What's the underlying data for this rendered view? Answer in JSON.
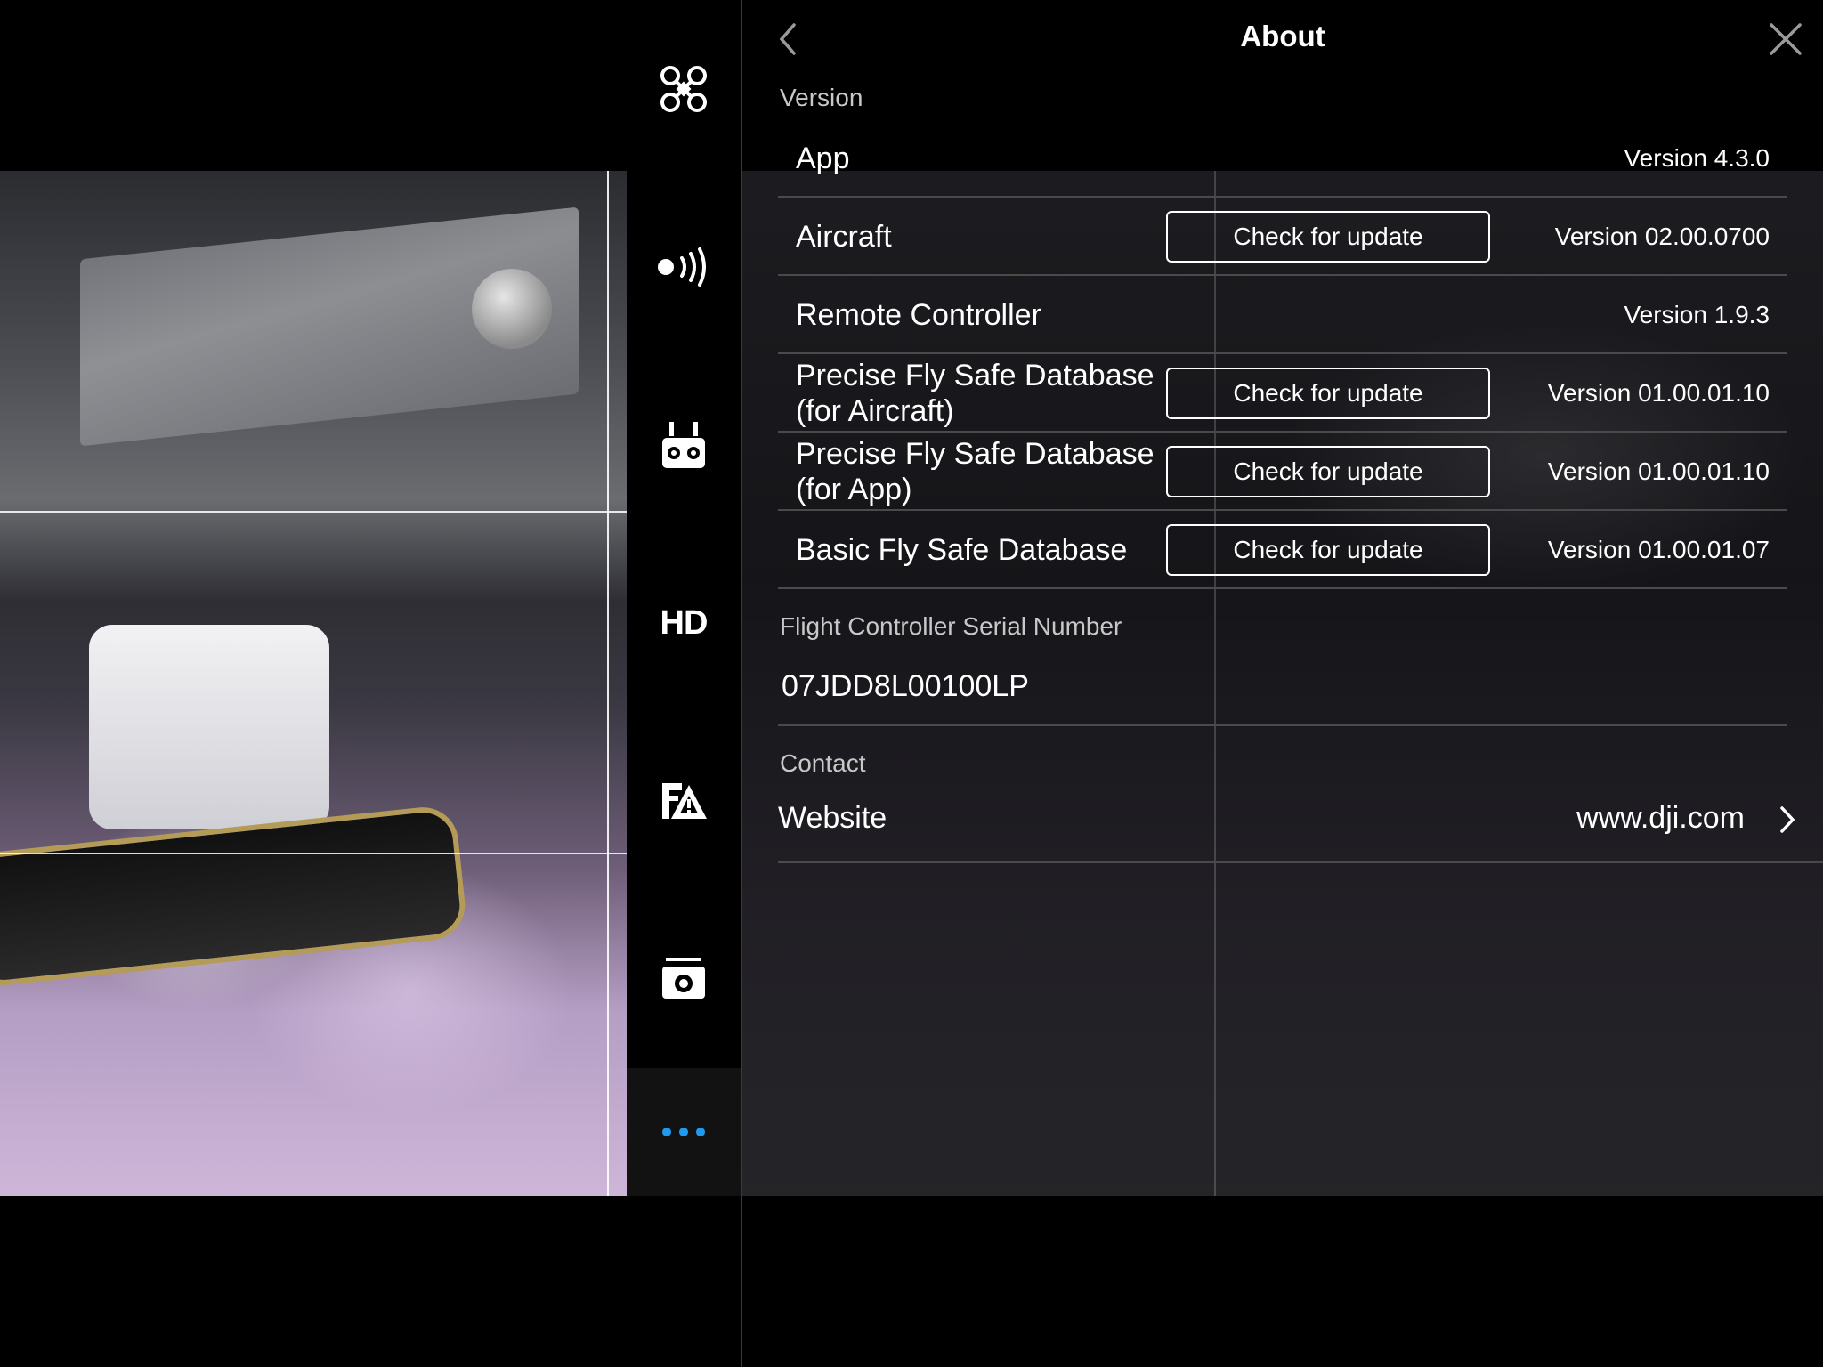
{
  "camera_view": {
    "grid": "3x3"
  },
  "side_nav": {
    "items": [
      {
        "id": "aircraft",
        "icon": "drone-icon"
      },
      {
        "id": "transmission",
        "icon": "signal-icon"
      },
      {
        "id": "remote",
        "icon": "remote-controller-icon"
      },
      {
        "id": "hd",
        "icon": "hd-icon",
        "label": "HD"
      },
      {
        "id": "battery",
        "icon": "battery-warning-icon"
      },
      {
        "id": "camera",
        "icon": "camera-icon"
      },
      {
        "id": "more",
        "icon": "more-icon",
        "active": true
      }
    ],
    "accent_color": "#1e9bf0"
  },
  "header": {
    "title": "About"
  },
  "version_section": {
    "label": "Version",
    "rows": [
      {
        "name": "App",
        "value": "Version 4.3.0",
        "has_button": false
      },
      {
        "name": "Aircraft",
        "value": "Version 02.00.0700",
        "has_button": true,
        "button": "Check for update"
      },
      {
        "name": "Remote Controller",
        "value": "Version 1.9.3",
        "has_button": false
      },
      {
        "name_line1": "Precise Fly Safe Database",
        "name_line2": "(for Aircraft)",
        "value": "Version 01.00.01.10",
        "has_button": true,
        "button": "Check for update"
      },
      {
        "name_line1": "Precise Fly Safe Database",
        "name_line2": "(for App)",
        "value": "Version 01.00.01.10",
        "has_button": true,
        "button": "Check for update"
      },
      {
        "name": "Basic Fly Safe Database",
        "value": "Version 01.00.01.07",
        "has_button": true,
        "button": "Check for update"
      }
    ]
  },
  "serial_section": {
    "label": "Flight Controller Serial Number",
    "value": "07JDD8L00100LP"
  },
  "contact_section": {
    "label": "Contact",
    "website_label": "Website",
    "website_value": "www.dji.com"
  }
}
